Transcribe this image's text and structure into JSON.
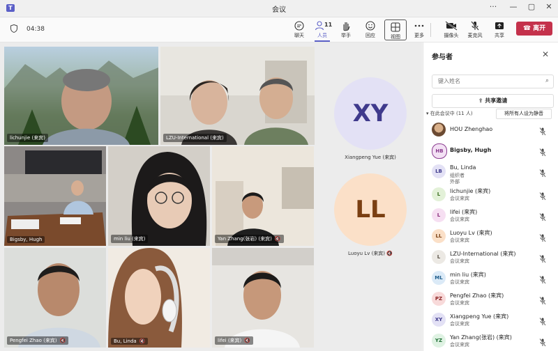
{
  "window": {
    "title": "会议",
    "controls": [
      "···",
      "—",
      "▢",
      "✕"
    ]
  },
  "toolbar": {
    "timer": "04:38",
    "buttons": [
      {
        "label": "聊天",
        "icon": "chat-icon"
      },
      {
        "label": "人员",
        "icon": "people-icon",
        "badge": "11"
      },
      {
        "label": "举手",
        "icon": "raise-hand-icon"
      },
      {
        "label": "回应",
        "icon": "react-icon"
      },
      {
        "label": "视图",
        "icon": "view-icon"
      },
      {
        "label": "更多",
        "icon": "more-icon"
      },
      {
        "label": "摄像头",
        "icon": "camera-off-icon"
      },
      {
        "label": "麦克风",
        "icon": "mic-off-icon"
      },
      {
        "label": "共享",
        "icon": "share-icon"
      }
    ],
    "leave_label": "离开"
  },
  "tiles": [
    {
      "name": "lichunjie (来宾)"
    },
    {
      "name": "LZU-International (来宾)"
    },
    {
      "name": "Bigsby, Hugh"
    },
    {
      "name": "min liu (来宾)"
    },
    {
      "name": "Yan Zhang(张岩) (来宾)"
    },
    {
      "name": "Pengfei Zhao (来宾)"
    },
    {
      "name": "Bu, Linda"
    },
    {
      "name": "lifei (来宾)"
    }
  ],
  "avatar_tiles": [
    {
      "initials": "XY",
      "name": "Xiangpeng Yue (来宾)",
      "color": "#e3e1f5",
      "text_color": "#3f3a8c"
    },
    {
      "initials": "LL",
      "name": "Luoyu Lv (来宾)",
      "color": "#fbe0c8",
      "text_color": "#7a3f12"
    }
  ],
  "panel": {
    "title": "参与者",
    "search_placeholder": "键入姓名",
    "share_invite": "共享邀请",
    "in_meeting": "▾ 在此会议中 (11 人)",
    "mute_all": "将所有人设为静音",
    "participants": [
      {
        "name": "HOU Zhenghao",
        "initials": "",
        "role": "",
        "role2": "",
        "color": "#c9a37a",
        "tcolor": "#fff",
        "bold": false
      },
      {
        "name": "Bigsby, Hugh",
        "initials": "HB",
        "role": "",
        "role2": "",
        "color": "#f3e1f4",
        "tcolor": "#8a3b8f",
        "bold": true
      },
      {
        "name": "Bu, Linda",
        "initials": "LB",
        "role": "组织者",
        "role2": "外部",
        "color": "#e3e1f5",
        "tcolor": "#3f3a8c",
        "bold": false
      },
      {
        "name": "lichunjie (来宾)",
        "initials": "L",
        "role": "会议来宾",
        "role2": "",
        "color": "#e3f1d8",
        "tcolor": "#3b6e1f",
        "bold": false
      },
      {
        "name": "lifei (来宾)",
        "initials": "L",
        "role": "会议来宾",
        "role2": "",
        "color": "#f6dff2",
        "tcolor": "#8a2f7c",
        "bold": false
      },
      {
        "name": "Luoyu Lv (来宾)",
        "initials": "LL",
        "role": "会议来宾",
        "role2": "",
        "color": "#fbe0c8",
        "tcolor": "#7a3f12",
        "bold": false
      },
      {
        "name": "LZU-International (来宾)",
        "initials": "L",
        "role": "会议来宾",
        "role2": "",
        "color": "#ece9e4",
        "tcolor": "#5a5348",
        "bold": false
      },
      {
        "name": "min liu (来宾)",
        "initials": "ML",
        "role": "会议来宾",
        "role2": "",
        "color": "#dbeaf7",
        "tcolor": "#1f5d8c",
        "bold": false
      },
      {
        "name": "Pengfei Zhao (来宾)",
        "initials": "PZ",
        "role": "会议来宾",
        "role2": "",
        "color": "#f8dada",
        "tcolor": "#8c2424",
        "bold": false
      },
      {
        "name": "Xiangpeng Yue (来宾)",
        "initials": "XY",
        "role": "会议来宾",
        "role2": "",
        "color": "#e3e1f5",
        "tcolor": "#3f3a8c",
        "bold": false
      },
      {
        "name": "Yan Zhang(张岩) (来宾)",
        "initials": "YZ",
        "role": "会议来宾",
        "role2": "",
        "color": "#dff2e3",
        "tcolor": "#1f6e34",
        "bold": false
      }
    ]
  }
}
